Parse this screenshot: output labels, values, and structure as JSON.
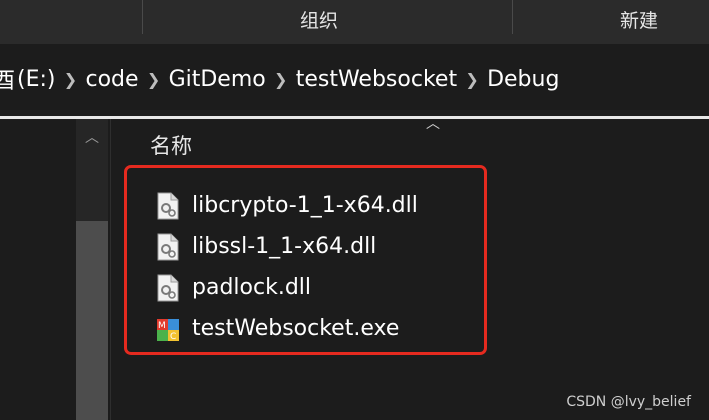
{
  "ribbon": {
    "groups": [
      "组织",
      "新建"
    ]
  },
  "address_bar": {
    "partial_drive": "(E:)",
    "crumbs": [
      "code",
      "GitDemo",
      "testWebsocket",
      "Debug"
    ]
  },
  "file_list": {
    "column_header": "名称",
    "files": [
      {
        "name": "libcrypto-1_1-x64.dll",
        "icon": "dll-file-icon"
      },
      {
        "name": "libssl-1_1-x64.dll",
        "icon": "dll-file-icon"
      },
      {
        "name": "padlock.dll",
        "icon": "dll-file-icon"
      },
      {
        "name": "testWebsocket.exe",
        "icon": "mfc-app-icon"
      }
    ]
  },
  "annotation": {
    "highlight_color": "#e52a1f"
  },
  "watermark": "CSDN @lvy_belief"
}
